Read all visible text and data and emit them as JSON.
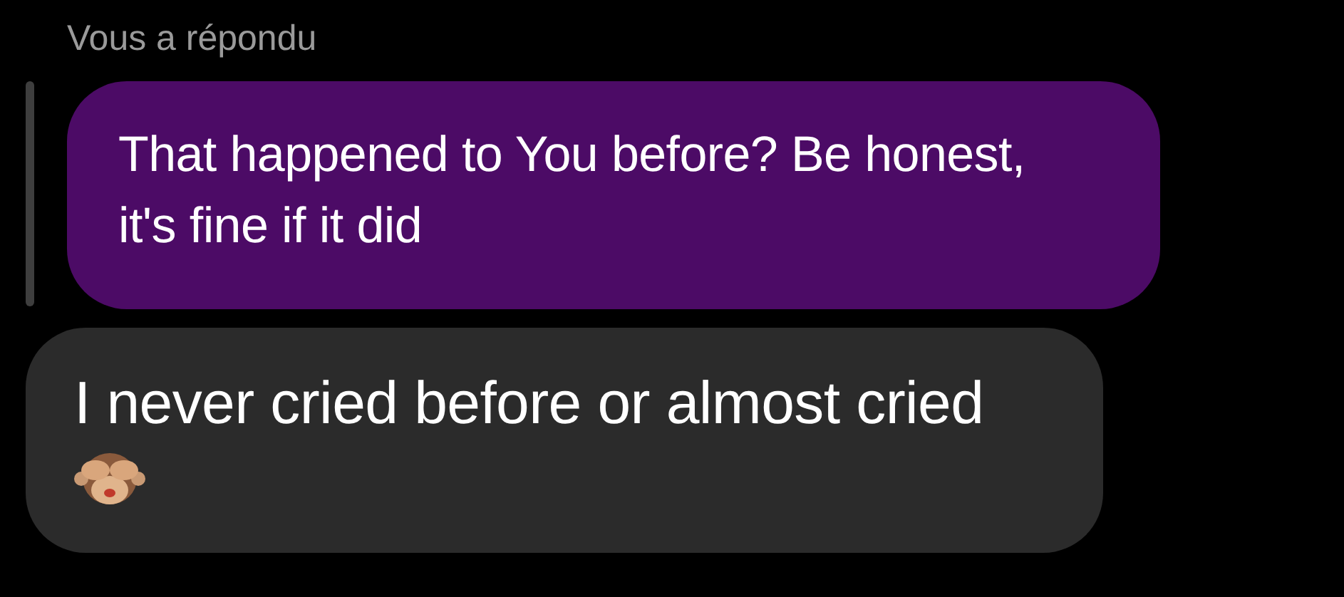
{
  "reply_label": "Vous a répondu",
  "quoted_message": {
    "lines": [
      "That happened to You before? Be honest,",
      "it's fine if it did"
    ]
  },
  "message": {
    "text": "I never cried before or almost cried"
  }
}
